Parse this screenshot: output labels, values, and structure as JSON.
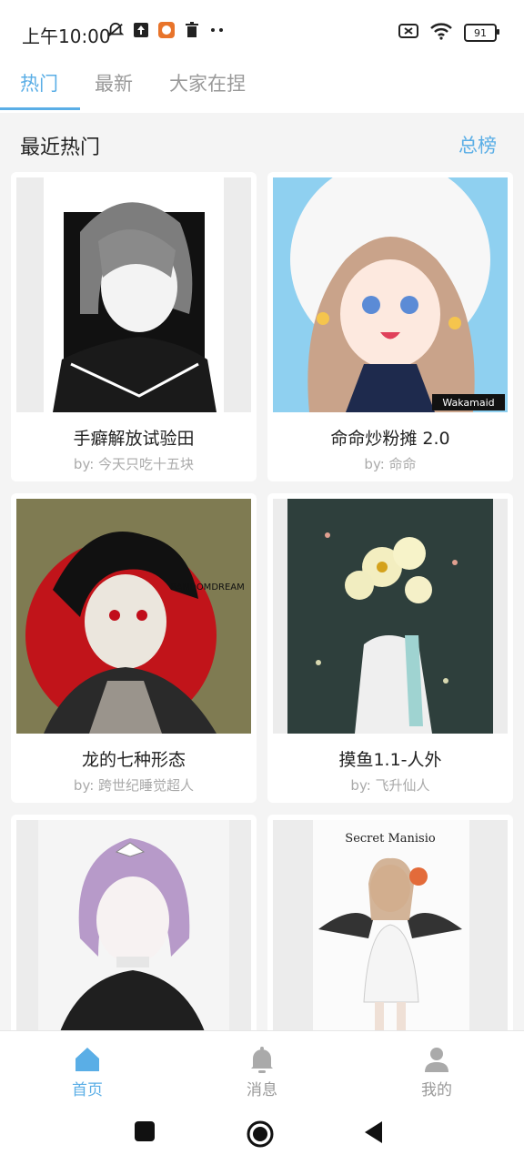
{
  "status_bar": {
    "time": "上午10:00",
    "battery": "91"
  },
  "tabs": [
    {
      "label": "热门",
      "active": true
    },
    {
      "label": "最新",
      "active": false
    },
    {
      "label": "大家在捏",
      "active": false
    }
  ],
  "section": {
    "title": "最近热门",
    "link": "总榜"
  },
  "cards": [
    {
      "title": "手癖解放试验田",
      "author": "by: 今天只吃十五块"
    },
    {
      "title": "命命炒粉摊 2.0",
      "author": "by: 命命"
    },
    {
      "title": "龙的七种形态",
      "author": "by: 跨世纪睡觉超人"
    },
    {
      "title": "摸鱼1.1-人外",
      "author": "by: 飞升仙人"
    },
    {
      "title": "",
      "author": ""
    },
    {
      "title": "",
      "author": ""
    }
  ],
  "thumb_text": {
    "card2_watermark": "Wakamaid",
    "card3_sign": "RANDOMDREAM",
    "card6_title": "Secret Manisio"
  },
  "bottom_nav": [
    {
      "label": "首页",
      "icon": "home-icon",
      "active": true
    },
    {
      "label": "消息",
      "icon": "bell-icon",
      "active": false
    },
    {
      "label": "我的",
      "icon": "user-icon",
      "active": false
    }
  ],
  "colors": {
    "accent": "#5aaee6",
    "muted": "#999999"
  }
}
